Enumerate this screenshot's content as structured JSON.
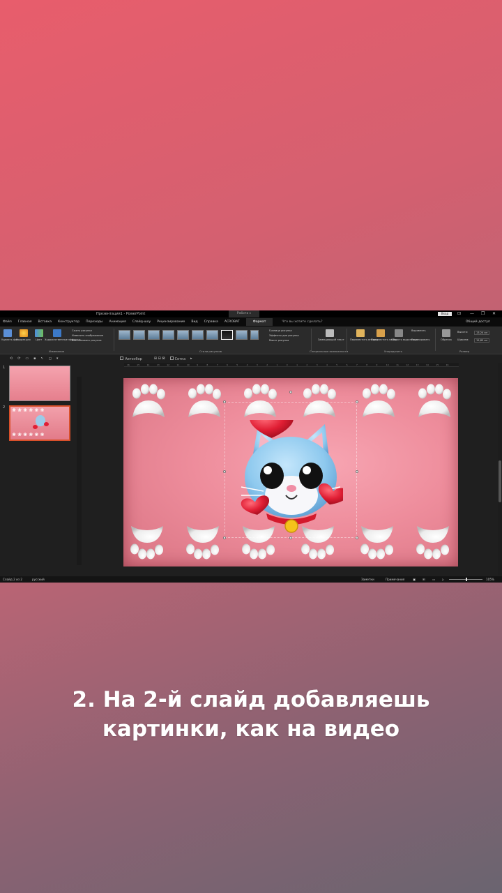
{
  "window": {
    "title": "Презентация1 - PowerPoint",
    "context_tab": "Работа с рисунками",
    "login_label": "Вход",
    "window_controls": [
      "⊡",
      "—",
      "❐",
      "✕"
    ]
  },
  "ribbon_tabs": [
    "Файл",
    "Главная",
    "Вставка",
    "Конструктор",
    "Переходы",
    "Анимация",
    "Слайд-шоу",
    "Рецензирование",
    "Вид",
    "Справка",
    "ACROBAT",
    "Формат"
  ],
  "active_tab": "Формат",
  "tell_me": "Что вы хотите сделать?",
  "share_label": "Общий доступ",
  "ribbon": {
    "remove_bg": "Удалить фон",
    "corrections": "Коррекция",
    "color": "Цвет",
    "artistic_effects": "Художественные эффекты",
    "compress": "Сжать рисунки",
    "change_picture": "Изменить изображение",
    "reset_picture": "Восстановить рисунок",
    "group_adjust": "Изменение",
    "group_styles": "Стили рисунков",
    "picture_border": "Граница рисунка",
    "picture_effects": "Эффекты для рисунка",
    "picture_layout": "Макет рисунка",
    "alt_text": "Замещающий текст",
    "group_accessibility": "Специальные возможности",
    "bring_forward": "Переместить вперед",
    "send_backward": "Переместить назад",
    "selection_pane": "Область выделения",
    "align": "Выровнять",
    "group": "Группировать",
    "group_arrange": "Упорядочить",
    "crop": "Обрезка",
    "height_label": "Высота:",
    "height_value": "13,24 см",
    "width_label": "Ширина:",
    "width_value": "15,85 см",
    "group_size": "Размер"
  },
  "qat": {
    "snap_label": "Автосбор",
    "grid_label": "Сетка"
  },
  "slides": [
    {
      "number": "1"
    },
    {
      "number": "2"
    }
  ],
  "ruler_ticks": [
    "16",
    "15",
    "14",
    "13",
    "12",
    "11",
    "10",
    "9",
    "8",
    "7",
    "6",
    "5",
    "4",
    "3",
    "2",
    "1",
    "0",
    "1",
    "2",
    "3",
    "4",
    "5",
    "6",
    "7",
    "8",
    "9",
    "10",
    "11",
    "12",
    "13",
    "14",
    "15",
    "16"
  ],
  "status": {
    "slide_counter": "Слайд 2 из 2",
    "language": "русский",
    "notes": "Заметки",
    "comments": "Примечания",
    "zoom": "105%"
  },
  "caption": {
    "line1": "2. На 2-й слайд добавляешь",
    "line2": "картинки, как на видео"
  },
  "colors": {
    "slide_pink": "#ee8d9c",
    "heart_red": "#e01e34",
    "cat_blue": "#8ec9ee"
  }
}
